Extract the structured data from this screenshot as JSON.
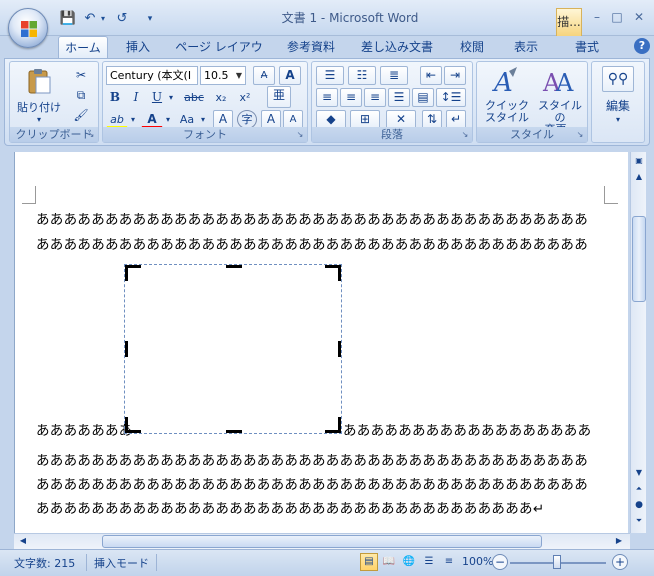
{
  "window": {
    "title": "文書 1 - Microsoft Word",
    "drawing_tools_tab": "描..."
  },
  "qat": {
    "save": "💾",
    "undo": "↶",
    "redo": "↺",
    "customize": "▾"
  },
  "window_controls": {
    "minimize": "–",
    "maximize": "□",
    "close": "✕"
  },
  "tabs": [
    {
      "label": "ホーム",
      "active": true
    },
    {
      "label": "挿入"
    },
    {
      "label": "ページ レイアウト"
    },
    {
      "label": "参考資料"
    },
    {
      "label": "差し込み文書"
    },
    {
      "label": "校閲"
    },
    {
      "label": "表示"
    },
    {
      "label": "書式"
    }
  ],
  "help": "?",
  "ribbon": {
    "clipboard": {
      "label": "クリップボード",
      "paste": "貼り付け",
      "paste_arrow": "▾"
    },
    "font": {
      "label": "フォント",
      "font_name": "Century (本文(I",
      "font_size": "10.5",
      "bold": "B",
      "italic": "I",
      "underline": "U",
      "strike": "abc",
      "subscript": "x₂",
      "superscript": "x²",
      "highlight": "ab",
      "font_color": "A",
      "change_case": "Aa",
      "char_border": "A",
      "enclose": "字",
      "grow": "A",
      "shrink": "A",
      "phonetic": "亜"
    },
    "paragraph": {
      "label": "段落"
    },
    "styles": {
      "label": "スタイル",
      "quick_styles_1": "クイック",
      "quick_styles_2": "スタイル ▾",
      "change_styles_1": "スタイルの",
      "change_styles_2": "変更 ▾"
    },
    "editing": {
      "label": "編集",
      "arrow": "▾"
    }
  },
  "document": {
    "lines": [
      "ああああああああああああああああああああああああああああああああああああああああ",
      "ああああああああああああああああああああああああああああああああああああああああ",
      "あああああああ",
      "ああああああああああああああああああ",
      "ああああああああああああああああああああああああああああああああああああああああ",
      "ああああああああああああああああああああああああああああああああああああああああ",
      "ああああああああああああああああああああああああああああああああああああ↵"
    ]
  },
  "statusbar": {
    "word_count": "文字数: 215",
    "insert_mode": "挿入モード",
    "zoom": "100%",
    "zoom_out": "−",
    "zoom_in": "+"
  }
}
